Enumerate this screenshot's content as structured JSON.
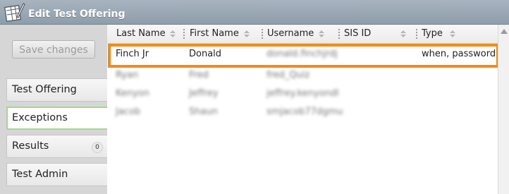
{
  "window": {
    "title": "Edit Test Offering",
    "icon": "edit-grid-icon"
  },
  "sidebar": {
    "save_label": "Save changes",
    "items": [
      {
        "label": "Test Offering"
      },
      {
        "label": "Exceptions",
        "active": true
      },
      {
        "label": "Results",
        "badge": "0"
      },
      {
        "label": "Test Admin"
      }
    ]
  },
  "table": {
    "columns": [
      "Last Name",
      "First Name",
      "Username",
      "SIS ID",
      "Type"
    ],
    "rows": [
      {
        "last": "Finch Jr",
        "first": "Donald",
        "username": "donald.finchjrdj",
        "sis": "",
        "type": "when, password"
      },
      {
        "last": "Ryan",
        "first": "Fred",
        "username": "fred_Quiz",
        "sis": "",
        "type": ""
      },
      {
        "last": "Kenyon",
        "first": "Jeffrey",
        "username": "jeffrey.kenyondl",
        "sis": "",
        "type": ""
      },
      {
        "last": "Jacob",
        "first": "Shaun",
        "username": "smjacob77dgmu",
        "sis": "",
        "type": ""
      }
    ]
  },
  "colors": {
    "highlight": "#f28b1a",
    "active_border": "#a5d88a",
    "titlebar": "#9aa8b5"
  }
}
